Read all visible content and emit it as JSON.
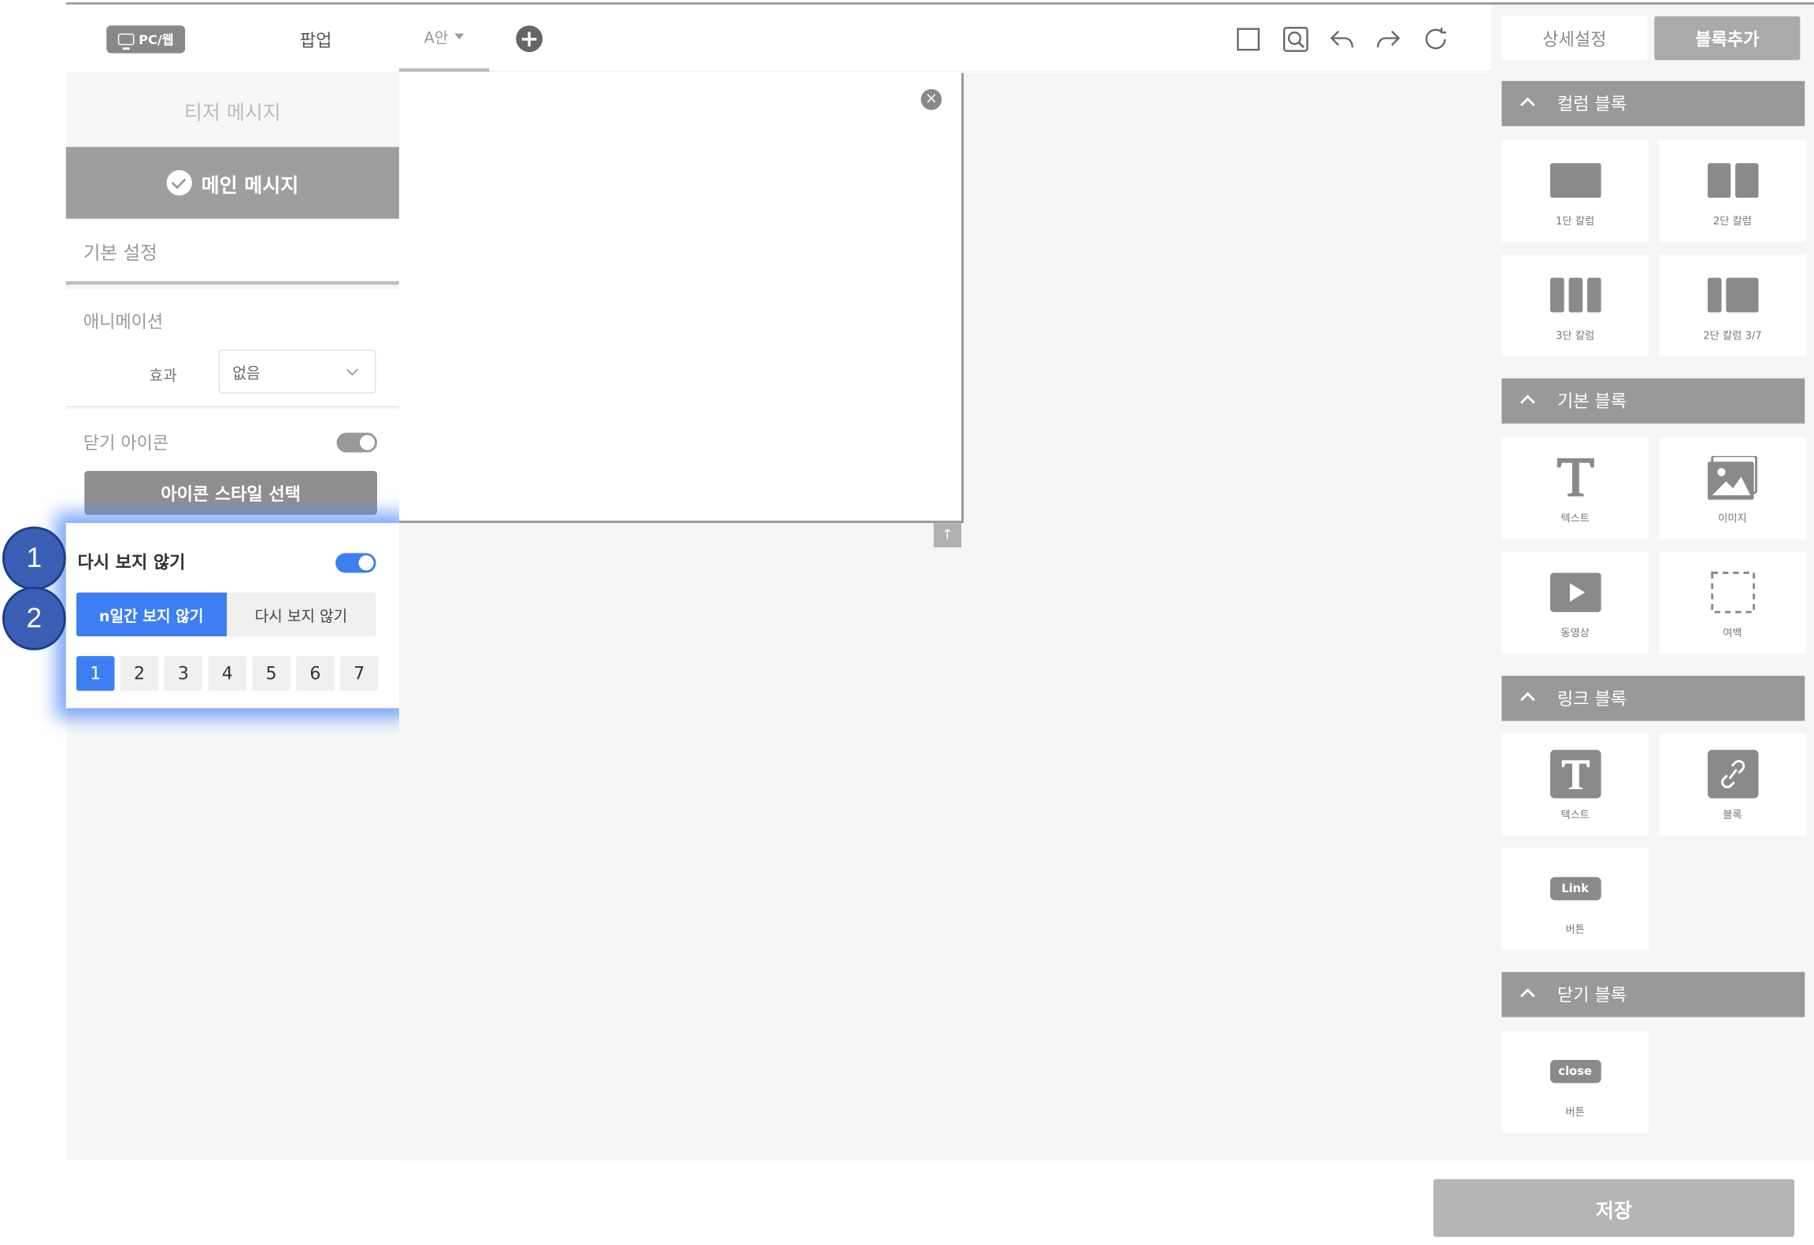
{
  "left_panel": {
    "device_tab": "PC/웹",
    "popup_tab": "팝업",
    "teaser_message": "티저 메시지",
    "main_message": "메인 메시지",
    "basic_settings": "기본 설정",
    "animation": {
      "title": "애니메이션",
      "effect_label": "효과",
      "effect_value": "없음"
    },
    "close_icon": {
      "title": "닫기 아이콘",
      "toggle_on": true,
      "style_button": "아이콘 스타일 선택"
    },
    "dont_show": {
      "title": "다시 보지 않기",
      "toggle_on": true,
      "options": [
        "n일간 보지 않기",
        "다시 보지 않기"
      ],
      "selected_option": 0,
      "days": [
        "1",
        "2",
        "3",
        "4",
        "5",
        "6",
        "7"
      ],
      "selected_day": 0
    }
  },
  "annotations": [
    "1",
    "2"
  ],
  "toolbar": {
    "variant_tab": "A안",
    "add_icon": "plus-icon",
    "tools": [
      "square-icon",
      "zoom-icon",
      "undo-icon",
      "redo-icon",
      "refresh-icon"
    ]
  },
  "canvas": {
    "close_icon": "×",
    "scroll_up_icon": "↑"
  },
  "right_panel": {
    "tab_detail": "상세설정",
    "tab_add_block": "블록추가",
    "sections": {
      "column": {
        "title": "컬럼 블록",
        "items": [
          "1단 칼럼",
          "2단 칼럼",
          "3단 칼럼",
          "2단 칼럼 3/7"
        ]
      },
      "basic": {
        "title": "기본 블록",
        "items": [
          "텍스트",
          "이미지",
          "동영상",
          "여백"
        ]
      },
      "link": {
        "title": "링크 블록",
        "items": [
          "텍스트",
          "블록",
          "버튼"
        ],
        "link_badge": "Link"
      },
      "close": {
        "title": "닫기 블록",
        "items": [
          "버튼"
        ],
        "close_badge": "close"
      }
    }
  },
  "footer": {
    "save_button": "저장"
  },
  "colors": {
    "accent": "#3d7ff2",
    "panel_header": "#999999",
    "annotation": "#3b5eb5"
  }
}
